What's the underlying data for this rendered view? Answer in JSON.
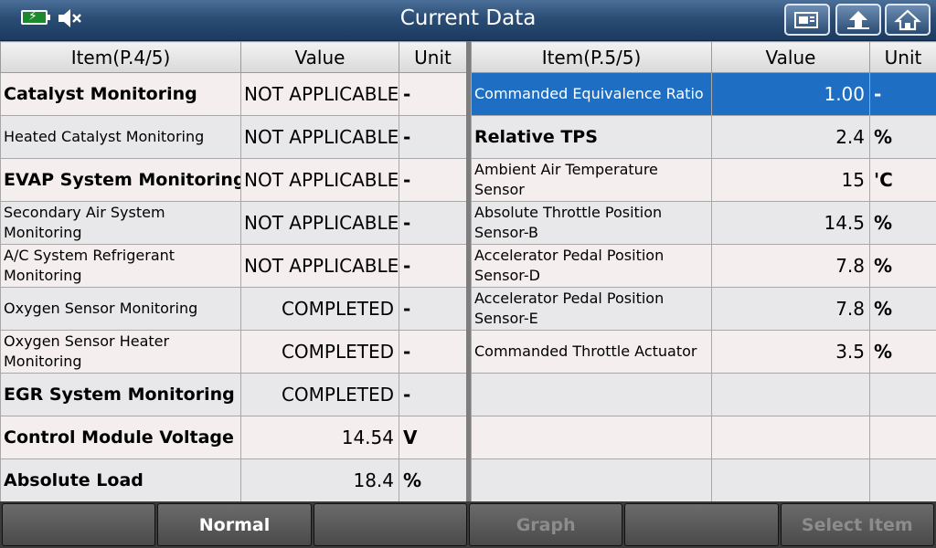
{
  "header": {
    "title": "Current Data",
    "icons": [
      "battery-charging-icon",
      "speaker-mute-icon",
      "screenshot-icon",
      "back-icon",
      "home-icon"
    ]
  },
  "left_table": {
    "columns": [
      "Item(P.4/5)",
      "Value",
      "Unit"
    ],
    "rows": [
      {
        "item": "Catalyst Monitoring",
        "value": "NOT APPLICABLE",
        "unit": "-"
      },
      {
        "item": "Heated Catalyst Monitoring",
        "value": "NOT APPLICABLE",
        "unit": "-"
      },
      {
        "item": "EVAP System Monitoring",
        "value": "NOT APPLICABLE",
        "unit": "-"
      },
      {
        "item": "Secondary Air System Monitoring",
        "value": "NOT APPLICABLE",
        "unit": "-"
      },
      {
        "item": "A/C System Refrigerant Monitoring",
        "value": "NOT APPLICABLE",
        "unit": "-"
      },
      {
        "item": "Oxygen Sensor Monitoring",
        "value": "COMPLETED",
        "unit": "-"
      },
      {
        "item": "Oxygen Sensor Heater Monitoring",
        "value": "COMPLETED",
        "unit": "-"
      },
      {
        "item": "EGR System Monitoring",
        "value": "COMPLETED",
        "unit": "-"
      },
      {
        "item": "Control Module Voltage",
        "value": "14.54",
        "unit": "V"
      },
      {
        "item": "Absolute Load",
        "value": "18.4",
        "unit": "%"
      }
    ]
  },
  "right_table": {
    "columns": [
      "Item(P.5/5)",
      "Value",
      "Unit"
    ],
    "rows": [
      {
        "item": "Commanded Equivalence Ratio",
        "value": "1.00",
        "unit": "-"
      },
      {
        "item": "Relative TPS",
        "value": "2.4",
        "unit": "%"
      },
      {
        "item": "Ambient Air Temperature Sensor",
        "value": "15",
        "unit": "'C"
      },
      {
        "item": "Absolute Throttle Position Sensor-B",
        "value": "14.5",
        "unit": "%"
      },
      {
        "item": "Accelerator Pedal Position Sensor-D",
        "value": "7.8",
        "unit": "%"
      },
      {
        "item": "Accelerator Pedal Position Sensor-E",
        "value": "7.8",
        "unit": "%"
      },
      {
        "item": "Commanded Throttle Actuator",
        "value": "3.5",
        "unit": "%"
      },
      {
        "item": "",
        "value": "",
        "unit": ""
      },
      {
        "item": "",
        "value": "",
        "unit": ""
      },
      {
        "item": "",
        "value": "",
        "unit": ""
      }
    ],
    "selected_row": "Commanded Equivalence Ratio"
  },
  "footer": {
    "buttons": [
      "",
      "Normal",
      "",
      "Graph",
      "",
      "Select Item"
    ]
  },
  "colors": {
    "title_bar": "#2b4d75",
    "selected_row": "#1e6fc3",
    "row_odd": "#f5eeee",
    "row_even": "#e8e8ea"
  }
}
